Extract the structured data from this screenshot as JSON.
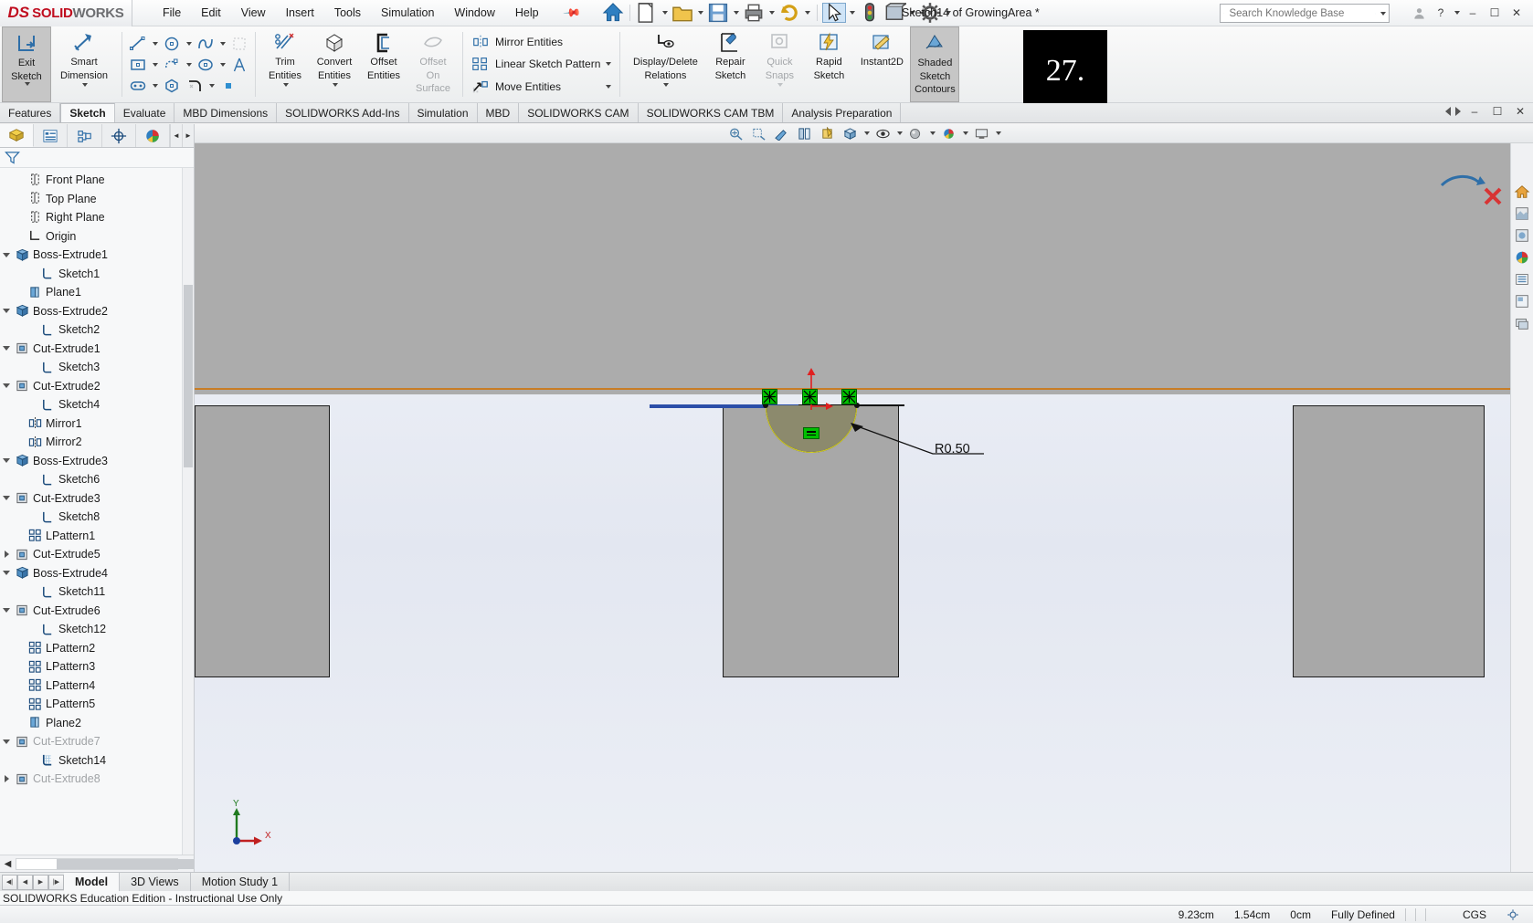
{
  "app": {
    "brand_ds": "DS",
    "brand_bold": "SOLID",
    "brand_light": "WORKS",
    "document_title": "Sketch14 of GrowingArea *",
    "badge_number": "27."
  },
  "menubar": {
    "items": [
      "File",
      "Edit",
      "View",
      "Insert",
      "Tools",
      "Simulation",
      "Window",
      "Help"
    ],
    "pin_icon": "pushpin-icon"
  },
  "quick_access": {
    "items": [
      {
        "name": "home-icon",
        "label": "Home"
      },
      {
        "name": "new-document-icon",
        "label": "New"
      },
      {
        "name": "open-document-icon",
        "label": "Open"
      },
      {
        "name": "save-icon",
        "label": "Save"
      },
      {
        "name": "print-icon",
        "label": "Print"
      },
      {
        "name": "undo-icon",
        "label": "Undo"
      },
      {
        "name": "select-arrow-icon",
        "label": "Select"
      },
      {
        "name": "measure-icon",
        "label": "Measure"
      },
      {
        "name": "display-style-icon",
        "label": "Display Style"
      },
      {
        "name": "options-gear-icon",
        "label": "Options"
      }
    ]
  },
  "search": {
    "placeholder": "Search Knowledge Base",
    "icon": "search-icon",
    "dropdown_icon": "chevron-down-icon"
  },
  "window_controls": {
    "account_icon": "user-account-icon",
    "help_icon": "question-mark-icon",
    "help_caret": "chevron-down-icon",
    "minimize": "minimize-icon",
    "maximize": "maximize-icon",
    "close": "close-icon"
  },
  "ribbon": {
    "groups": [
      {
        "name": "exit-sketch-group",
        "buttons": [
          {
            "label": "Exit\nSketch",
            "line1": "Exit",
            "line2": "Sketch",
            "icon": "exit-sketch-icon",
            "active": true,
            "has_dropdown": true
          },
          {
            "label": "Smart Dimension",
            "line1": "Smart",
            "line2": "Dimension",
            "icon": "smart-dimension-icon",
            "active": false,
            "has_dropdown": true
          }
        ]
      }
    ],
    "sketch_tools": [
      {
        "name": "line-icon",
        "dropdown": true
      },
      {
        "name": "circle-icon",
        "dropdown": true
      },
      {
        "name": "spline-icon",
        "dropdown": true
      },
      {
        "name": "trim-grid-icon",
        "dropdown": false,
        "disabled": true
      },
      {
        "name": "rectangle-icon",
        "dropdown": true
      },
      {
        "name": "slot-arc-icon",
        "dropdown": true
      },
      {
        "name": "ellipse-icon",
        "dropdown": true
      },
      {
        "name": "text-icon",
        "dropdown": false
      },
      {
        "name": "straight-slot-icon",
        "dropdown": true
      },
      {
        "name": "polygon-icon",
        "dropdown": false
      },
      {
        "name": "fillet-icon",
        "dropdown": true
      },
      {
        "name": "point-icon",
        "dropdown": false
      }
    ],
    "entity_buttons": [
      {
        "line1": "Trim",
        "line2": "Entities",
        "icon": "trim-entities-icon",
        "has_dropdown": true,
        "disabled": false
      },
      {
        "line1": "Convert",
        "line2": "Entities",
        "icon": "convert-entities-icon",
        "has_dropdown": true,
        "disabled": false
      },
      {
        "line1": "Offset",
        "line2": "Entities",
        "icon": "offset-entities-icon",
        "has_dropdown": false,
        "disabled": false
      },
      {
        "line1": "Offset",
        "line2": "On",
        "line3": "Surface",
        "icon": "offset-on-surface-icon",
        "has_dropdown": false,
        "disabled": true
      }
    ],
    "text_buttons": [
      {
        "label": "Mirror Entities",
        "icon": "mirror-entities-icon",
        "has_dropdown": false
      },
      {
        "label": "Linear Sketch Pattern",
        "icon": "linear-sketch-pattern-icon",
        "has_dropdown": true
      },
      {
        "label": "Move Entities",
        "icon": "move-entities-icon",
        "has_dropdown": true
      }
    ],
    "right_buttons": [
      {
        "line1": "Display/Delete",
        "line2": "Relations",
        "icon": "display-delete-relations-icon",
        "has_dropdown": true,
        "disabled": false,
        "wide": true
      },
      {
        "line1": "Repair",
        "line2": "Sketch",
        "icon": "repair-sketch-icon",
        "has_dropdown": false,
        "disabled": false
      },
      {
        "line1": "Quick",
        "line2": "Snaps",
        "icon": "quick-snaps-icon",
        "has_dropdown": true,
        "disabled": true
      },
      {
        "line1": "Rapid",
        "line2": "Sketch",
        "icon": "rapid-sketch-icon",
        "has_dropdown": false,
        "disabled": false
      },
      {
        "line1": "Instant2D",
        "line2": "",
        "icon": "instant2d-icon",
        "has_dropdown": false,
        "disabled": false
      },
      {
        "line1": "Shaded",
        "line2": "Sketch",
        "line3": "Contours",
        "icon": "shaded-sketch-contours-icon",
        "has_dropdown": false,
        "disabled": false,
        "active": true
      }
    ]
  },
  "command_tabs": {
    "items": [
      {
        "label": "Features",
        "selected": false
      },
      {
        "label": "Sketch",
        "selected": true
      },
      {
        "label": "Evaluate",
        "selected": false
      },
      {
        "label": "MBD Dimensions",
        "selected": false
      },
      {
        "label": "SOLIDWORKS Add-Ins",
        "selected": false
      },
      {
        "label": "Simulation",
        "selected": false
      },
      {
        "label": "MBD",
        "selected": false
      },
      {
        "label": "SOLIDWORKS CAM",
        "selected": false
      },
      {
        "label": "SOLIDWORKS CAM TBM",
        "selected": false
      },
      {
        "label": "Analysis Preparation",
        "selected": false
      }
    ]
  },
  "feature_manager": {
    "tabs": [
      {
        "name": "feature-tree-tab",
        "icon": "feature-tree-icon",
        "selected": true
      },
      {
        "name": "property-manager-tab",
        "icon": "property-manager-icon",
        "selected": false
      },
      {
        "name": "configuration-manager-tab",
        "icon": "configuration-manager-icon",
        "selected": false
      },
      {
        "name": "dimxpert-manager-tab",
        "icon": "dimxpert-icon",
        "selected": false
      },
      {
        "name": "display-manager-tab",
        "icon": "display-manager-icon",
        "selected": false
      }
    ],
    "filter_icon": "filter-funnel-icon",
    "tree": [
      {
        "label": "Front Plane",
        "icon": "plane-icon",
        "indent": 1,
        "expander": "none",
        "dim": false
      },
      {
        "label": "Top Plane",
        "icon": "plane-icon",
        "indent": 1,
        "expander": "none",
        "dim": false
      },
      {
        "label": "Right Plane",
        "icon": "plane-icon",
        "indent": 1,
        "expander": "none",
        "dim": false
      },
      {
        "label": "Origin",
        "icon": "origin-icon",
        "indent": 1,
        "expander": "none",
        "dim": false
      },
      {
        "label": "Boss-Extrude1",
        "icon": "boss-extrude-icon",
        "indent": 0,
        "expander": "down",
        "dim": false
      },
      {
        "label": "Sketch1",
        "icon": "sketch-icon",
        "indent": 2,
        "expander": "none",
        "dim": false
      },
      {
        "label": "Plane1",
        "icon": "plane-blue-icon",
        "indent": 1,
        "expander": "none",
        "dim": false
      },
      {
        "label": "Boss-Extrude2",
        "icon": "boss-extrude-icon",
        "indent": 0,
        "expander": "down",
        "dim": false
      },
      {
        "label": "Sketch2",
        "icon": "sketch-icon",
        "indent": 2,
        "expander": "none",
        "dim": false
      },
      {
        "label": "Cut-Extrude1",
        "icon": "cut-extrude-icon",
        "indent": 0,
        "expander": "down",
        "dim": false
      },
      {
        "label": "Sketch3",
        "icon": "sketch-icon",
        "indent": 2,
        "expander": "none",
        "dim": false
      },
      {
        "label": "Cut-Extrude2",
        "icon": "cut-extrude-icon",
        "indent": 0,
        "expander": "down",
        "dim": false
      },
      {
        "label": "Sketch4",
        "icon": "sketch-icon",
        "indent": 2,
        "expander": "none",
        "dim": false
      },
      {
        "label": "Mirror1",
        "icon": "mirror-icon",
        "indent": 1,
        "expander": "none",
        "dim": false
      },
      {
        "label": "Mirror2",
        "icon": "mirror-icon",
        "indent": 1,
        "expander": "none",
        "dim": false
      },
      {
        "label": "Boss-Extrude3",
        "icon": "boss-extrude-icon",
        "indent": 0,
        "expander": "down",
        "dim": false
      },
      {
        "label": "Sketch6",
        "icon": "sketch-icon",
        "indent": 2,
        "expander": "none",
        "dim": false
      },
      {
        "label": "Cut-Extrude3",
        "icon": "cut-extrude-icon",
        "indent": 0,
        "expander": "down",
        "dim": false
      },
      {
        "label": "Sketch8",
        "icon": "sketch-icon",
        "indent": 2,
        "expander": "none",
        "dim": false
      },
      {
        "label": "LPattern1",
        "icon": "lpattern-icon",
        "indent": 1,
        "expander": "none",
        "dim": false
      },
      {
        "label": "Cut-Extrude5",
        "icon": "cut-extrude-icon",
        "indent": 0,
        "expander": "right",
        "dim": false
      },
      {
        "label": "Boss-Extrude4",
        "icon": "boss-extrude-icon",
        "indent": 0,
        "expander": "down",
        "dim": false
      },
      {
        "label": "Sketch11",
        "icon": "sketch-icon",
        "indent": 2,
        "expander": "none",
        "dim": false
      },
      {
        "label": "Cut-Extrude6",
        "icon": "cut-extrude-icon",
        "indent": 0,
        "expander": "down",
        "dim": false
      },
      {
        "label": "Sketch12",
        "icon": "sketch-icon",
        "indent": 2,
        "expander": "none",
        "dim": false
      },
      {
        "label": "LPattern2",
        "icon": "lpattern-icon",
        "indent": 1,
        "expander": "none",
        "dim": false
      },
      {
        "label": "LPattern3",
        "icon": "lpattern-icon",
        "indent": 1,
        "expander": "none",
        "dim": false
      },
      {
        "label": "LPattern4",
        "icon": "lpattern-icon",
        "indent": 1,
        "expander": "none",
        "dim": false
      },
      {
        "label": "LPattern5",
        "icon": "lpattern-icon",
        "indent": 1,
        "expander": "none",
        "dim": false
      },
      {
        "label": "Plane2",
        "icon": "plane-blue-icon",
        "indent": 1,
        "expander": "none",
        "dim": false
      },
      {
        "label": "Cut-Extrude7",
        "icon": "cut-extrude-icon",
        "indent": 0,
        "expander": "down",
        "dim": true
      },
      {
        "label": "Sketch14",
        "icon": "sketch-active-icon",
        "indent": 2,
        "expander": "none",
        "dim": false
      },
      {
        "label": "Cut-Extrude8",
        "icon": "cut-extrude-icon",
        "indent": 0,
        "expander": "right",
        "dim": true
      }
    ]
  },
  "viewport": {
    "toolbar": [
      {
        "name": "zoom-to-fit-icon",
        "dropdown": false
      },
      {
        "name": "zoom-to-area-icon",
        "dropdown": false
      },
      {
        "name": "previous-view-icon",
        "dropdown": false
      },
      {
        "name": "section-view-icon",
        "dropdown": false
      },
      {
        "name": "view-orientation-icon",
        "dropdown": false
      },
      {
        "name": "display-style-icon",
        "dropdown": true
      },
      {
        "name": "hide-show-items-icon",
        "dropdown": true
      },
      {
        "name": "edit-appearance-icon",
        "dropdown": true
      },
      {
        "name": "apply-scene-icon",
        "dropdown": true
      },
      {
        "name": "view-settings-icon",
        "dropdown": true
      }
    ],
    "annotations": {
      "radius_dimension": "R0.50",
      "relations": [
        {
          "name": "coincident-relation-glyph"
        },
        {
          "name": "coincident-relation-glyph"
        },
        {
          "name": "coincident-relation-glyph"
        },
        {
          "name": "equal-relation-glyph"
        }
      ],
      "origin_axis_x": "x-axis-arrow",
      "origin_axis_y": "y-axis-arrow"
    },
    "triad": {
      "x_label": "X",
      "y_label": "Y"
    },
    "right_toolbar": [
      {
        "name": "view-home-icon"
      },
      {
        "name": "appearances-icon"
      },
      {
        "name": "scenes-icon"
      },
      {
        "name": "decals-icon"
      },
      {
        "name": "lights-cameras-icon"
      },
      {
        "name": "custom-views-icon"
      },
      {
        "name": "display-states-icon"
      }
    ]
  },
  "bottom_tabs": {
    "nav": [
      "first-record-icon",
      "previous-record-icon",
      "next-record-icon",
      "last-record-icon"
    ],
    "items": [
      {
        "label": "Model",
        "selected": true
      },
      {
        "label": "3D Views",
        "selected": false
      },
      {
        "label": "Motion Study 1",
        "selected": false
      }
    ]
  },
  "status_bar": {
    "education_notice": "SOLIDWORKS Education Edition - Instructional Use Only",
    "coord_x": "9.23cm",
    "coord_y": "1.54cm",
    "coord_z": "0cm",
    "sketch_state": "Fully Defined",
    "units": "CGS",
    "settings_icon": "units-settings-icon"
  }
}
